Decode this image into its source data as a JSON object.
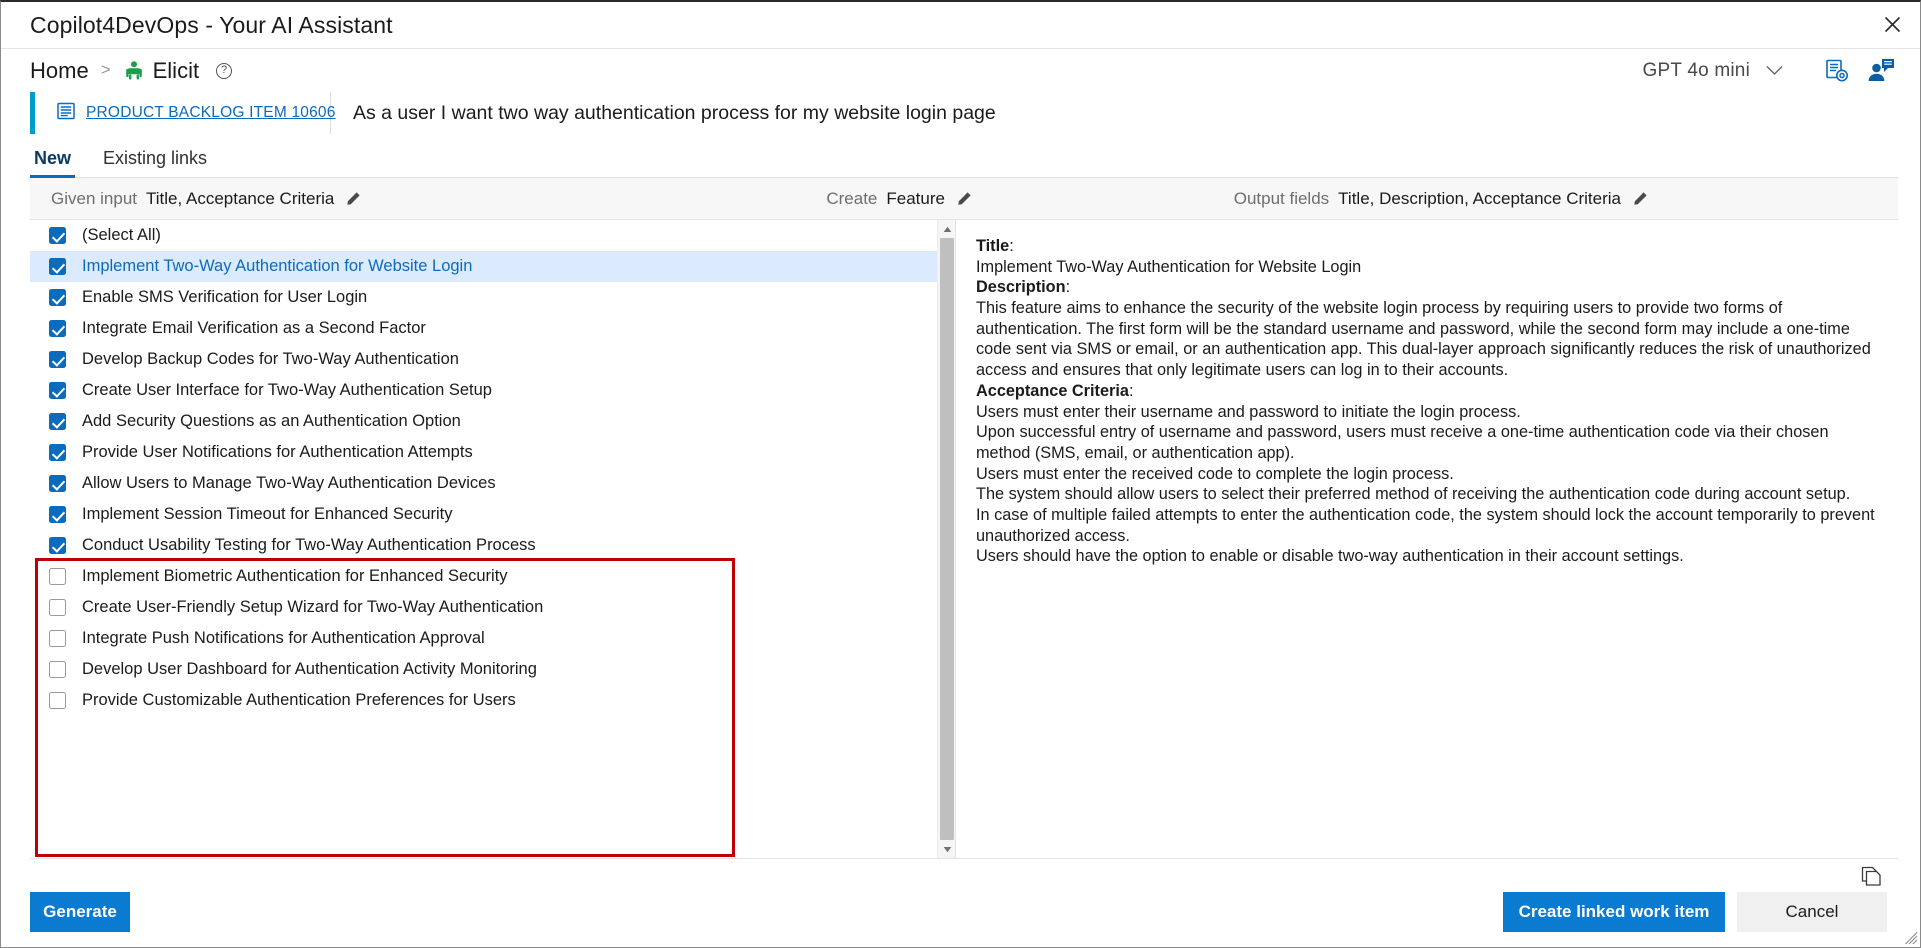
{
  "window": {
    "title": "Copilot4DevOps - Your AI Assistant",
    "close_label": "×"
  },
  "breadcrumb": {
    "home": "Home",
    "separator": ">",
    "current": "Elicit",
    "help_label": "?"
  },
  "header_right": {
    "model": "GPT 4o mini",
    "chevron": "⌄",
    "doc_settings_icon": "document-settings-icon",
    "user_chat_icon": "user-chat-icon"
  },
  "work_item": {
    "type_link": "PRODUCT BACKLOG ITEM 10606",
    "title": "As a user I want two way authentication process for my website login page",
    "icon": "backlog-item-icon"
  },
  "tabs": [
    {
      "label": "New",
      "active": true
    },
    {
      "label": "Existing links",
      "active": false
    }
  ],
  "options": {
    "given_input": {
      "label": "Given input",
      "value": "Title, Acceptance Criteria"
    },
    "create": {
      "label": "Create",
      "value": "Feature"
    },
    "output_fields": {
      "label": "Output fields",
      "value": "Title, Description, Acceptance Criteria"
    }
  },
  "list": {
    "items": [
      {
        "label": "(Select All)",
        "checked": true,
        "selected": false
      },
      {
        "label": "Implement Two-Way Authentication for Website Login",
        "checked": true,
        "selected": true
      },
      {
        "label": "Enable SMS Verification for User Login",
        "checked": true,
        "selected": false
      },
      {
        "label": "Integrate Email Verification as a Second Factor",
        "checked": true,
        "selected": false
      },
      {
        "label": "Develop Backup Codes for Two-Way Authentication",
        "checked": true,
        "selected": false
      },
      {
        "label": "Create User Interface for Two-Way Authentication Setup",
        "checked": true,
        "selected": false
      },
      {
        "label": "Add Security Questions as an Authentication Option",
        "checked": true,
        "selected": false
      },
      {
        "label": "Provide User Notifications for Authentication Attempts",
        "checked": true,
        "selected": false
      },
      {
        "label": "Allow Users to Manage Two-Way Authentication Devices",
        "checked": true,
        "selected": false
      },
      {
        "label": "Implement Session Timeout for Enhanced Security",
        "checked": true,
        "selected": false
      },
      {
        "label": "Conduct Usability Testing for Two-Way Authentication Process",
        "checked": true,
        "selected": false
      },
      {
        "label": "Implement Biometric Authentication for Enhanced Security",
        "checked": false,
        "selected": false
      },
      {
        "label": "Create User-Friendly Setup Wizard for Two-Way Authentication",
        "checked": false,
        "selected": false
      },
      {
        "label": "Integrate Push Notifications for Authentication Approval",
        "checked": false,
        "selected": false
      },
      {
        "label": "Develop User Dashboard for Authentication Activity Monitoring",
        "checked": false,
        "selected": false
      },
      {
        "label": "Provide Customizable Authentication Preferences for Users",
        "checked": false,
        "selected": false
      }
    ],
    "scrollbar": {
      "up_arrow": "▲",
      "down_arrow": "▼"
    }
  },
  "detail": {
    "title_label": "Title",
    "title_value": "Implement Two-Way Authentication for Website Login",
    "description_label": "Description",
    "description_value": "This feature aims to enhance the security of the website login process by requiring users to provide two forms of authentication. The first form will be the standard username and password, while the second form may include a one-time code sent via SMS or email, or an authentication app. This dual-layer approach significantly reduces the risk of unauthorized access and ensures that only legitimate users can log in to their accounts.",
    "acceptance_label": "Acceptance Criteria",
    "acceptance_lines": [
      "Users must enter their username and password to initiate the login process.",
      "Upon successful entry of username and password, users must receive a one-time authentication code via their chosen method (SMS, email, or authentication app).",
      "Users must enter the received code to complete the login process.",
      "The system should allow users to select their preferred method of receiving the authentication code during account setup.",
      "In case of multiple failed attempts to enter the authentication code, the system should lock the account temporarily to prevent unauthorized access.",
      "Users should have the option to enable or disable two-way authentication in their account settings."
    ]
  },
  "footer": {
    "generate": "Generate",
    "create_linked": "Create linked work item",
    "cancel": "Cancel",
    "copy_icon": "copy-icon"
  },
  "colors": {
    "accent_blue": "#0b7ad1",
    "link_blue": "#0b6bbd",
    "selection_blue": "#dbeafc",
    "highlight_red": "#c00000",
    "work_item_bar": "#009ccc",
    "elicit_green": "#1a9e4b"
  }
}
